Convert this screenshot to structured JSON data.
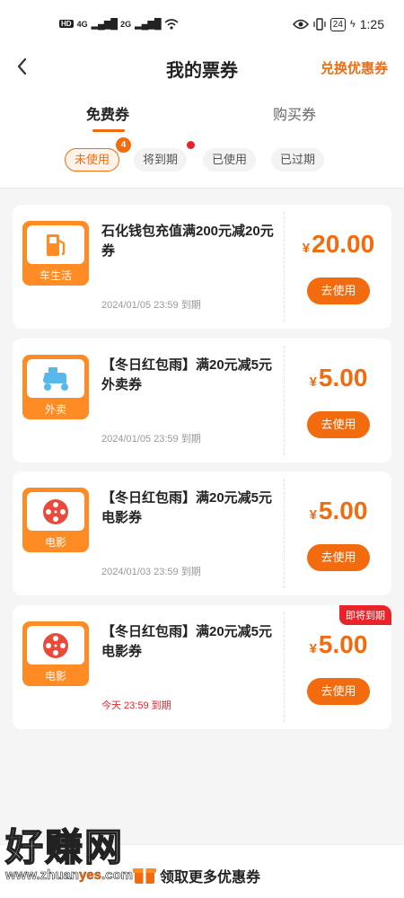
{
  "status_bar": {
    "hd": "HD",
    "signal_1": "4G",
    "signal_2": "2G",
    "battery": "24",
    "time": "1:25"
  },
  "header": {
    "title": "我的票券",
    "exchange_label": "兑换优惠券"
  },
  "tabs": [
    {
      "label": "免费券",
      "active": true
    },
    {
      "label": "购买券",
      "active": false
    }
  ],
  "filters": {
    "items": [
      {
        "label": "未使用",
        "active": true
      },
      {
        "label": "将到期",
        "active": false
      },
      {
        "label": "已使用",
        "active": false
      },
      {
        "label": "已过期",
        "active": false
      }
    ],
    "unused_count": "4"
  },
  "coupons": [
    {
      "icon": "fuel-pump-icon",
      "icon_label": "车生活",
      "title": "石化钱包充值满200元减20元券",
      "expire": "2024/01/05 23:59 到期",
      "currency": "¥",
      "amount": "20.00",
      "button": "去使用",
      "tag": ""
    },
    {
      "icon": "scooter-icon",
      "icon_label": "外卖",
      "title": "【冬日红包雨】满20元减5元外卖券",
      "expire": "2024/01/05 23:59 到期",
      "currency": "¥",
      "amount": "5.00",
      "button": "去使用",
      "tag": ""
    },
    {
      "icon": "film-reel-icon",
      "icon_label": "电影",
      "title": "【冬日红包雨】满20元减5元电影券",
      "expire": "2024/01/03 23:59 到期",
      "currency": "¥",
      "amount": "5.00",
      "button": "去使用",
      "tag": ""
    },
    {
      "icon": "film-reel-icon",
      "icon_label": "电影",
      "title": "【冬日红包雨】满20元减5元电影券",
      "expire": "今天 23:59 到期",
      "currency": "¥",
      "amount": "5.00",
      "button": "去使用",
      "tag": "即将到期"
    }
  ],
  "bottom": {
    "label": "领取更多优惠券"
  },
  "watermark": {
    "text": "好赚网",
    "url_prefix": "www.zhuan",
    "url_highlight": "yes",
    "url_suffix": ".com"
  },
  "colors": {
    "accent": "#f26b0f",
    "danger": "#e8232a",
    "background": "#f5f5f5"
  }
}
